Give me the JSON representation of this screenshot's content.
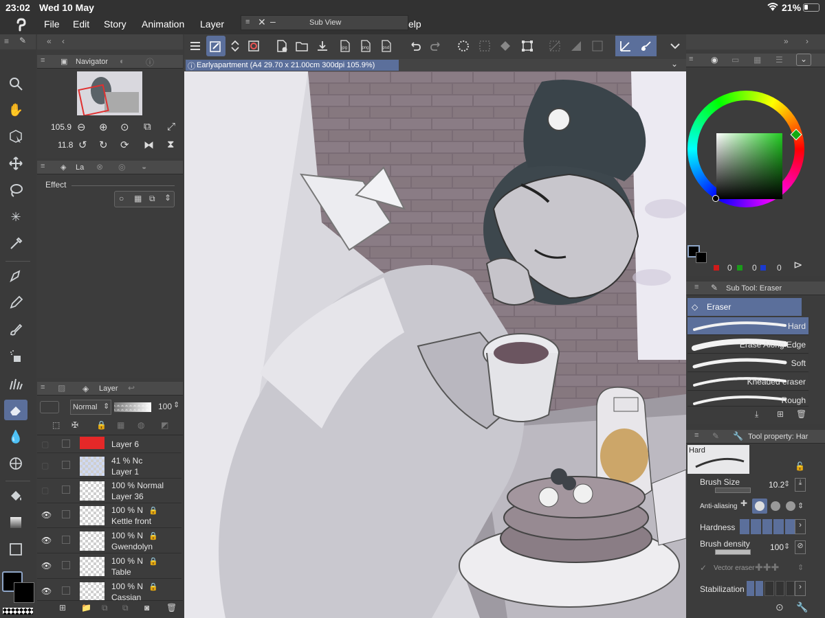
{
  "status": {
    "time": "23:02",
    "date": "Wed 10 May",
    "battery": "21%"
  },
  "menu": [
    "File",
    "Edit",
    "Story",
    "Animation",
    "Layer",
    "Help"
  ],
  "menu_help_partial": "elp",
  "subview": {
    "title": "Sub View"
  },
  "canvas": {
    "title": "Earlyapartment (A4 29.70 x 21.00cm 300dpi 105.9%)"
  },
  "toolbar_icons": [
    "menu-icon",
    "quick-access-icon",
    "updown-icon",
    "color-icon",
    "new-icon",
    "open-icon",
    "save-icon",
    "jpg-export-icon",
    "png-export-icon",
    "psd-export-icon",
    "undo-icon",
    "redo-icon",
    "loading-icon",
    "deselect-icon",
    "fill-icon",
    "transform-icon",
    "clear-icon",
    "clear-outside-icon",
    "select-icon",
    "snap-icon",
    "ruler-icon",
    "chevron-down-icon"
  ],
  "navigator": {
    "title": "Navigator",
    "zoom": "105.9",
    "rotation": "11.8"
  },
  "layer_props": {
    "tab": "La",
    "effect_label": "Effect"
  },
  "layer_panel": {
    "title": "Layer",
    "blend_mode": "Normal",
    "opacity": "100",
    "layers": [
      {
        "pct": "",
        "mode": "",
        "name": "Layer 6",
        "visible": false,
        "locked": false,
        "thumb": "red"
      },
      {
        "pct": "41 %",
        "mode": "Nc",
        "name": "Layer 1",
        "visible": false,
        "locked": false,
        "thumb": "blue"
      },
      {
        "pct": "100 %",
        "mode": "Normal",
        "name": "Layer 36",
        "visible": false,
        "locked": false,
        "thumb": "check"
      },
      {
        "pct": "100 %",
        "mode": "N",
        "name": "Kettle front",
        "visible": true,
        "locked": true,
        "thumb": "check"
      },
      {
        "pct": "100 %",
        "mode": "N",
        "name": "Gwendolyn",
        "visible": true,
        "locked": true,
        "thumb": "check"
      },
      {
        "pct": "100 %",
        "mode": "N",
        "name": "Table",
        "visible": true,
        "locked": true,
        "thumb": "check"
      },
      {
        "pct": "100 %",
        "mode": "N",
        "name": "Cassian",
        "visible": true,
        "locked": true,
        "thumb": "check"
      }
    ]
  },
  "color": {
    "r": "0",
    "g": "0",
    "b": "0",
    "hue_color": "#33cc33"
  },
  "subtool": {
    "title": "Sub Tool: Eraser",
    "group": "Eraser",
    "brushes": [
      "Hard",
      "Erase Along Edge",
      "Soft",
      "Kneaded eraser",
      "Rough"
    ]
  },
  "tool_property": {
    "title": "Tool property: Har",
    "preset": "Hard",
    "brush_size_label": "Brush Size",
    "brush_size": "10.2",
    "antialias_label": "Anti-aliasing",
    "hardness_label": "Hardness",
    "density_label": "Brush density",
    "density": "100",
    "vector_label": "Vector eraser",
    "stabilization_label": "Stabilization"
  }
}
